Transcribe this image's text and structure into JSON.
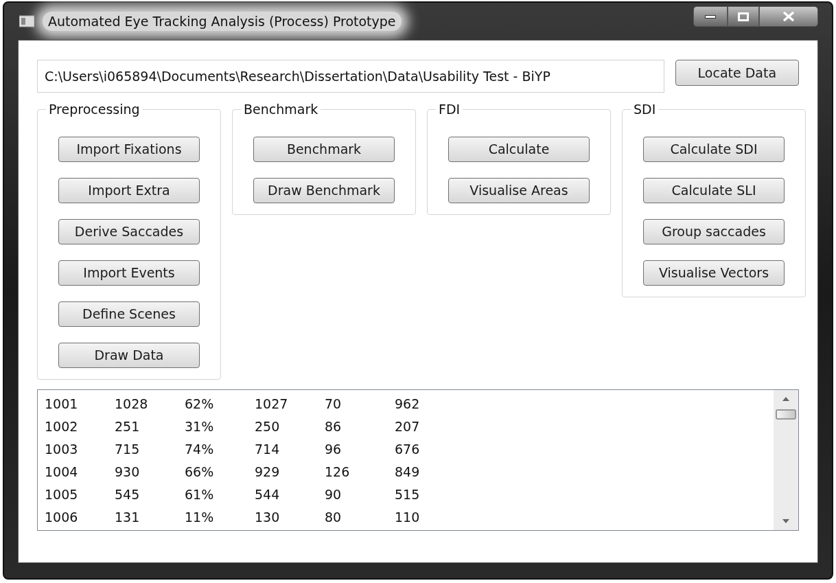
{
  "window": {
    "title": "Automated Eye Tracking Analysis (Process) Prototype"
  },
  "path_field": {
    "value": "C:\\Users\\i065894\\Documents\\Research\\Dissertation\\Data\\Usability Test - BiYP"
  },
  "locate_button": "Locate Data",
  "groups": [
    {
      "title": "Preprocessing",
      "buttons": [
        "Import Fixations",
        "Import Extra",
        "Derive Saccades",
        "Import Events",
        "Define Scenes",
        "Draw Data"
      ]
    },
    {
      "title": "Benchmark",
      "buttons": [
        "Benchmark",
        "Draw Benchmark"
      ]
    },
    {
      "title": "FDI",
      "buttons": [
        "Calculate",
        "Visualise Areas"
      ]
    },
    {
      "title": "SDI",
      "buttons": [
        "Calculate SDI",
        "Calculate SLI",
        "Group saccades",
        "Visualise Vectors"
      ]
    }
  ],
  "results": [
    [
      "1001",
      "1028",
      "62%",
      "1027",
      "70",
      "962"
    ],
    [
      "1002",
      "251",
      "31%",
      "250",
      "86",
      "207"
    ],
    [
      "1003",
      "715",
      "74%",
      "714",
      "96",
      "676"
    ],
    [
      "1004",
      "930",
      "66%",
      "929",
      "126",
      "849"
    ],
    [
      "1005",
      "545",
      "61%",
      "544",
      "90",
      "515"
    ],
    [
      "1006",
      "131",
      "11%",
      "130",
      "80",
      "110"
    ]
  ]
}
